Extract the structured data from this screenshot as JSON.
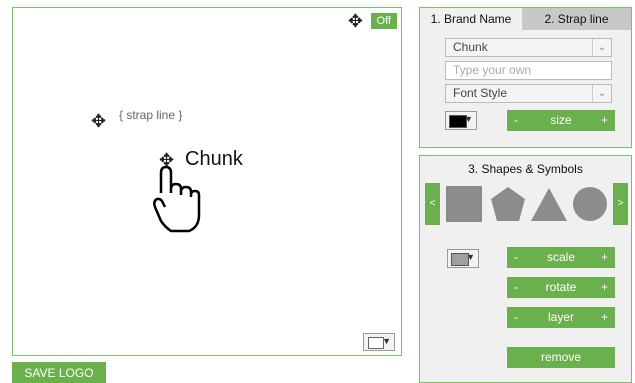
{
  "canvas": {
    "toggle_label": "Off",
    "strap_line": "{ strap line }",
    "brand_text": "Chunk"
  },
  "save_button": "SAVE LOGO",
  "panel_brand": {
    "tab1": "1. Brand Name",
    "tab2": "2. Strap line",
    "font_select": "Chunk",
    "custom_placeholder": "Type your own",
    "style_select": "Font Style",
    "color": "#000000",
    "size": {
      "minus": "-",
      "label": "size",
      "plus": "+"
    }
  },
  "panel_shapes": {
    "title": "3. Shapes & Symbols",
    "prev": "<",
    "next": ">",
    "shapes": [
      "square-icon",
      "pentagon-icon",
      "triangle-icon",
      "circle-icon"
    ],
    "shape_color": "#8c8c8c",
    "color": "#a0a0a0",
    "controls": [
      {
        "minus": "-",
        "label": "scale",
        "plus": "+"
      },
      {
        "minus": "-",
        "label": "rotate",
        "plus": "+"
      },
      {
        "minus": "-",
        "label": "layer",
        "plus": "+"
      }
    ],
    "remove": "remove"
  },
  "colors": {
    "accent": "#6ab04c",
    "border": "#7bc06a"
  }
}
